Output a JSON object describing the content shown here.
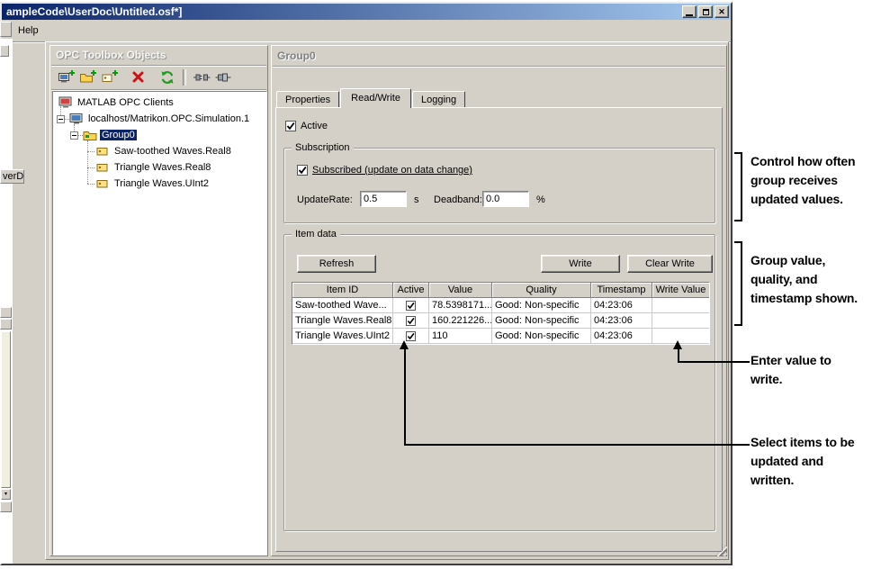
{
  "window": {
    "title": "ampleCode\\UserDoc\\Untitled.osf*]",
    "menu_items": [
      "Help"
    ]
  },
  "fragments": {
    "tab_text": "verDA"
  },
  "tree_panel": {
    "title": "OPC Toolbox Objects",
    "toolbar_icons": [
      "add-client-icon",
      "add-group-icon",
      "add-item-icon",
      "delete-icon",
      "refresh-icon",
      "disconnect-icon",
      "connect-icon"
    ],
    "nodes": [
      {
        "label": "MATLAB OPC Clients",
        "selected": false
      },
      {
        "label": "localhost/Matrikon.OPC.Simulation.1",
        "selected": false
      },
      {
        "label": "Group0",
        "selected": true
      },
      {
        "label": "Saw-toothed Waves.Real8",
        "selected": false
      },
      {
        "label": "Triangle Waves.Real8",
        "selected": false
      },
      {
        "label": "Triangle Waves.UInt2",
        "selected": false
      }
    ]
  },
  "detail_panel": {
    "title": "Group0",
    "tabs": [
      {
        "label": "Properties",
        "active": false
      },
      {
        "label": "Read/Write",
        "active": true
      },
      {
        "label": "Logging",
        "active": false
      }
    ],
    "active_checkbox": {
      "label": "Active",
      "checked": true
    },
    "subscription": {
      "legend": "Subscription",
      "subscribed_checkbox": {
        "label": "Subscribed (update on data change)",
        "checked": true
      },
      "update_rate_label": "UpdateRate:",
      "update_rate_value": "0.5",
      "update_rate_unit": "s",
      "deadband_label": "Deadband:",
      "deadband_value": "0.0",
      "deadband_unit": "%"
    },
    "item_data": {
      "legend": "Item data",
      "refresh_button": "Refresh",
      "write_button": "Write",
      "clear_write_button": "Clear Write",
      "table": {
        "columns": [
          "Item ID",
          "Active",
          "Value",
          "Quality",
          "Timestamp",
          "Write Value"
        ],
        "rows": [
          {
            "item_id": "Saw-toothed Wave...",
            "active": true,
            "value": "78.5398171...",
            "quality": "Good: Non-specific",
            "timestamp": "04:23:06",
            "write_value": ""
          },
          {
            "item_id": "Triangle Waves.Real8",
            "active": true,
            "value": "160.221226...",
            "quality": "Good: Non-specific",
            "timestamp": "04:23:06",
            "write_value": ""
          },
          {
            "item_id": "Triangle Waves.UInt2",
            "active": true,
            "value": "110",
            "quality": "Good: Non-specific",
            "timestamp": "04:23:06",
            "write_value": ""
          }
        ]
      }
    }
  },
  "annotations": {
    "subscription_note": "Control how often\ngroup receives\nupdated values.",
    "table_note": "Group value,\nquality, and\ntimestamp shown.",
    "write_note": "Enter value to\nwrite.",
    "select_note": "Select items to be\nupdated and\nwritten."
  },
  "colors": {
    "titlebar_start": "#0a246a",
    "titlebar_end": "#a6caf0",
    "window_bg": "#d4d0c8",
    "selection_bg": "#0a246a",
    "annotation_color": "#000000"
  }
}
